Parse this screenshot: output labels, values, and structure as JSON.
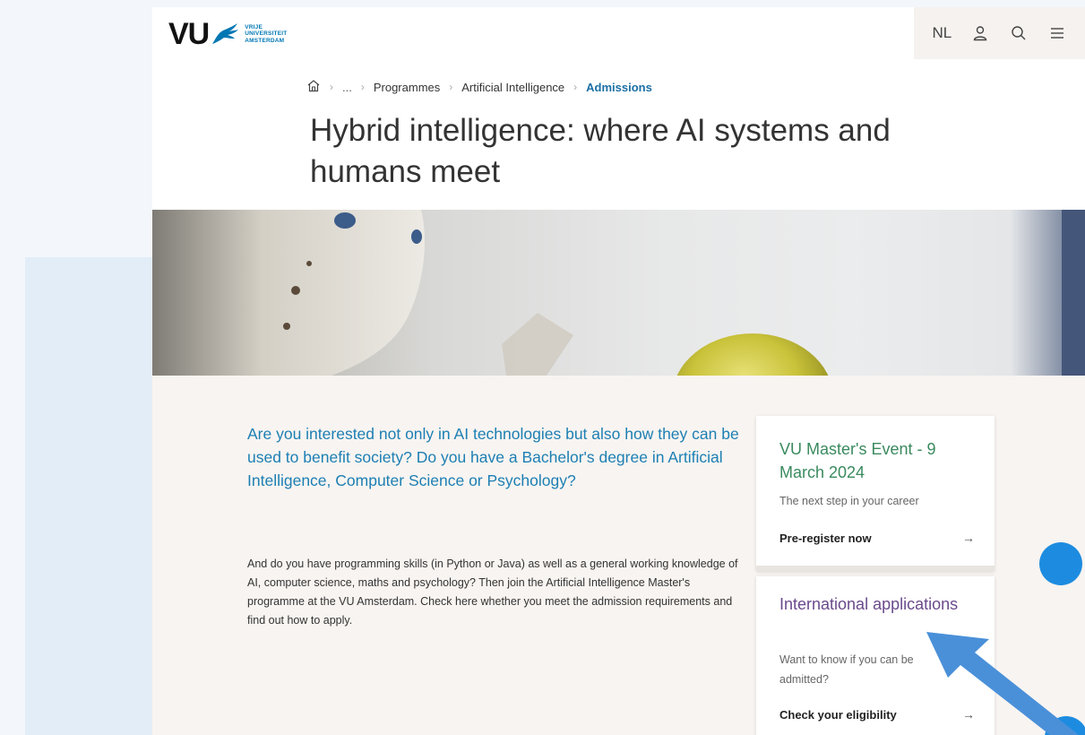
{
  "header": {
    "logo": {
      "wordmark": "VU",
      "lines": [
        "VRIJE",
        "UNIVERSITEIT",
        "AMSTERDAM"
      ]
    },
    "language_label": "NL",
    "icons": [
      "user-icon",
      "search-icon",
      "menu-icon"
    ]
  },
  "breadcrumb": {
    "items": [
      "...",
      "Programmes",
      "Artificial Intelligence",
      "Admissions"
    ]
  },
  "page_title": "Hybrid intelligence: where AI systems and humans meet",
  "main": {
    "lead": "Are you interested not only in AI technologies but also how they can be used to benefit society? Do you have a Bachelor's degree in Artificial Intelligence, Computer Science or Psychology?",
    "body": "And do you have programming skills (in Python or Java) as well as a general working knowledge of AI, computer science, maths and psychology? Then join the Artificial Intelligence Master's programme at the VU Amsterdam. Check here whether you meet the admission requirements and find out how to apply."
  },
  "cards": [
    {
      "title": "VU Master's Event - 9 March 2024",
      "subtitle": "The next step in your career",
      "link": "Pre-register now",
      "color": "#3a8a5e"
    },
    {
      "title": "International applications",
      "subtitle": "Want to know if you can be admitted?",
      "link": "Check your eligibility",
      "color": "#6a4a8c"
    }
  ],
  "colors": {
    "accent": "#1d7fb3",
    "float_button": "#1d8ce0",
    "pointer_arrow": "#4a90d9"
  }
}
